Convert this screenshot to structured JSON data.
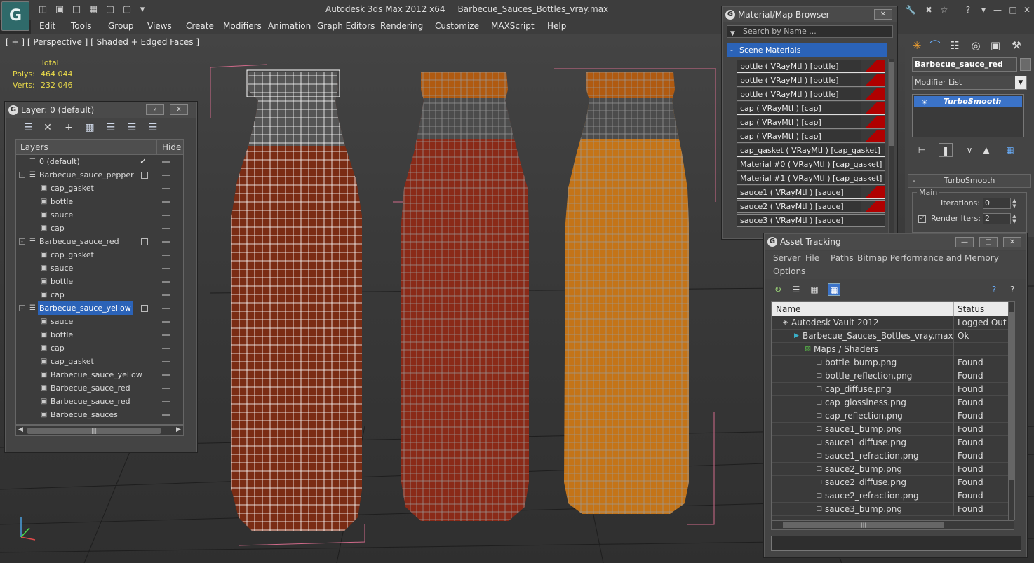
{
  "app": {
    "title": "Autodesk 3ds Max  2012 x64",
    "file": "Barbecue_Sauces_Bottles_vray.max"
  },
  "menu": [
    "Edit",
    "Tools",
    "Group",
    "Views",
    "Create",
    "Modifiers",
    "Animation",
    "Graph Editors",
    "Rendering",
    "Customize",
    "MAXScript",
    "Help"
  ],
  "viewport": {
    "label": "[ + ] [ Perspective ] [ Shaded + Edged Faces ]",
    "stats": {
      "header": "Total",
      "polys_label": "Polys:",
      "polys": "464 044",
      "verts_label": "Verts:",
      "verts": "232 046"
    },
    "colors": {
      "bottle1": "#7a2a14",
      "bottle2": "#8a2a1a",
      "bottle3": "#c87818",
      "cap": "#b05a10",
      "wire": "#ffffff"
    }
  },
  "layer_panel": {
    "title": "Layer: 0 (default)",
    "help_label": "?",
    "close_label": "X",
    "col_layers": "Layers",
    "col_hide": "Hide",
    "rows": [
      {
        "name": "0 (default)",
        "level": 0,
        "type": "layer",
        "current": true
      },
      {
        "name": "Barbecue_sauce_pepper",
        "level": 0,
        "type": "layer",
        "expand": "-"
      },
      {
        "name": "cap_gasket",
        "level": 1,
        "type": "object"
      },
      {
        "name": "bottle",
        "level": 1,
        "type": "object"
      },
      {
        "name": "sauce",
        "level": 1,
        "type": "object"
      },
      {
        "name": "cap",
        "level": 1,
        "type": "object"
      },
      {
        "name": "Barbecue_sauce_red",
        "level": 0,
        "type": "layer",
        "expand": "-"
      },
      {
        "name": "cap_gasket",
        "level": 1,
        "type": "object"
      },
      {
        "name": "sauce",
        "level": 1,
        "type": "object"
      },
      {
        "name": "bottle",
        "level": 1,
        "type": "object"
      },
      {
        "name": "cap",
        "level": 1,
        "type": "object"
      },
      {
        "name": "Barbecue_sauce_yellow",
        "level": 0,
        "type": "layer",
        "expand": "-",
        "selected": true
      },
      {
        "name": "sauce",
        "level": 1,
        "type": "object"
      },
      {
        "name": "bottle",
        "level": 1,
        "type": "object"
      },
      {
        "name": "cap",
        "level": 1,
        "type": "object"
      },
      {
        "name": "cap_gasket",
        "level": 1,
        "type": "object"
      },
      {
        "name": "Barbecue_sauce_yellow",
        "level": 1,
        "type": "object"
      },
      {
        "name": "Barbecue_sauce_red",
        "level": 1,
        "type": "object"
      },
      {
        "name": "Barbecue_sauce_red",
        "level": 1,
        "type": "object"
      },
      {
        "name": "Barbecue_sauces",
        "level": 1,
        "type": "object"
      }
    ]
  },
  "material_browser": {
    "title": "Material/Map Browser",
    "search_placeholder": "Search by Name ...",
    "section": "Scene Materials",
    "items": [
      {
        "label": "bottle  ( VRayMtl )  [bottle]",
        "swatch": true,
        "framed": true
      },
      {
        "label": "bottle  ( VRayMtl )  [bottle]",
        "swatch": true
      },
      {
        "label": "bottle  ( VRayMtl )  [bottle]",
        "swatch": true
      },
      {
        "label": "cap  ( VRayMtl )  [cap]",
        "swatch": true,
        "framed": true
      },
      {
        "label": "cap  ( VRayMtl )  [cap]",
        "swatch": true
      },
      {
        "label": "cap  ( VRayMtl )  [cap]",
        "swatch": true
      },
      {
        "label": "cap_gasket  ( VRayMtl )  [cap_gasket]",
        "swatch": false,
        "framed": true
      },
      {
        "label": "Material #0  ( VRayMtl )  [cap_gasket]",
        "swatch": false
      },
      {
        "label": "Material #1  ( VRayMtl )  [cap_gasket]",
        "swatch": false
      },
      {
        "label": "sauce1  ( VRayMtl )  [sauce]",
        "swatch": true,
        "framed": true
      },
      {
        "label": "sauce2  ( VRayMtl )  [sauce]",
        "swatch": true
      },
      {
        "label": "sauce3  ( VRayMtl )  [sauce]",
        "swatch": false
      }
    ]
  },
  "command_panel": {
    "object_name": "Barbecue_sauce_red",
    "modifier_list": "Modifier List",
    "stack_item": "TurboSmooth",
    "rollout": "TurboSmooth",
    "group": "Main",
    "iterations_label": "Iterations:",
    "iterations": "0",
    "render_iters_label": "Render Iters:",
    "render_iters": "2"
  },
  "asset_tracking": {
    "title": "Asset Tracking",
    "menu": [
      "Server",
      "File",
      "Paths",
      "Bitmap Performance and Memory",
      "Options"
    ],
    "col_name": "Name",
    "col_status": "Status",
    "rows": [
      {
        "name": "Autodesk Vault 2012",
        "status": "Logged Out ..",
        "indent": 0,
        "icon": "vault-icon"
      },
      {
        "name": "Barbecue_Sauces_Bottles_vray.max",
        "status": "Ok",
        "indent": 1,
        "icon": "max-file-icon"
      },
      {
        "name": "Maps / Shaders",
        "status": "",
        "indent": 2,
        "icon": "maps-folder-icon"
      },
      {
        "name": "bottle_bump.png",
        "status": "Found",
        "indent": 3,
        "icon": "bitmap-icon"
      },
      {
        "name": "bottle_reflection.png",
        "status": "Found",
        "indent": 3,
        "icon": "bitmap-icon"
      },
      {
        "name": "cap_diffuse.png",
        "status": "Found",
        "indent": 3,
        "icon": "bitmap-icon"
      },
      {
        "name": "cap_glossiness.png",
        "status": "Found",
        "indent": 3,
        "icon": "bitmap-icon"
      },
      {
        "name": "cap_reflection.png",
        "status": "Found",
        "indent": 3,
        "icon": "bitmap-icon"
      },
      {
        "name": "sauce1_bump.png",
        "status": "Found",
        "indent": 3,
        "icon": "bitmap-icon"
      },
      {
        "name": "sauce1_diffuse.png",
        "status": "Found",
        "indent": 3,
        "icon": "bitmap-icon"
      },
      {
        "name": "sauce1_refraction.png",
        "status": "Found",
        "indent": 3,
        "icon": "bitmap-icon"
      },
      {
        "name": "sauce2_bump.png",
        "status": "Found",
        "indent": 3,
        "icon": "bitmap-icon"
      },
      {
        "name": "sauce2_diffuse.png",
        "status": "Found",
        "indent": 3,
        "icon": "bitmap-icon"
      },
      {
        "name": "sauce2_refraction.png",
        "status": "Found",
        "indent": 3,
        "icon": "bitmap-icon"
      },
      {
        "name": "sauce3_bump.png",
        "status": "Found",
        "indent": 3,
        "icon": "bitmap-icon"
      }
    ]
  }
}
